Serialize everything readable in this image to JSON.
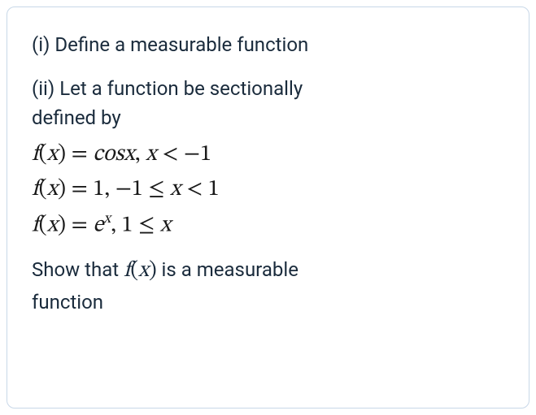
{
  "problem": {
    "part1": "(i) Define a measurable function",
    "part2_intro_line1": "(ii) Let a function be sectionally",
    "part2_intro_line2": "defined by",
    "equations": {
      "eq1": {
        "lhs_f": "f",
        "lhs_var": "x",
        "rhs": "cosx",
        "comma": ", ",
        "cond_var": "x",
        "cond_op": " < ",
        "cond_val": "−1"
      },
      "eq2": {
        "lhs_f": "f",
        "lhs_var": "x",
        "rhs": "1",
        "comma": ", ",
        "cond_lo": "−1",
        "cond_op1": " ≤ ",
        "cond_var": "x",
        "cond_op2": " < ",
        "cond_hi": "1"
      },
      "eq3": {
        "lhs_f": "f",
        "lhs_var": "x",
        "rhs_base": "e",
        "rhs_exp": "x",
        "comma": ", ",
        "cond_lo": "1",
        "cond_op": " ≤ ",
        "cond_var": "x"
      }
    },
    "conclusion_pre": "Show that ",
    "conclusion_fn_f": "f",
    "conclusion_fn_var": "x",
    "conclusion_post1": " is a measurable",
    "conclusion_post2": "function"
  }
}
